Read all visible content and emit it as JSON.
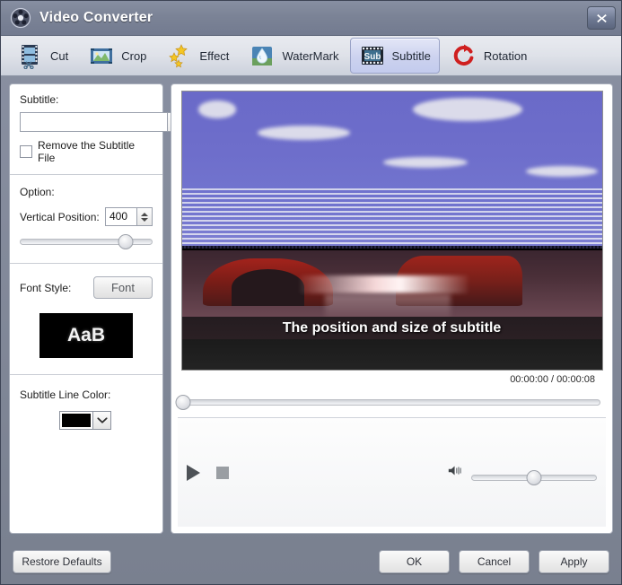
{
  "window": {
    "title": "Video Converter",
    "logo_icon": "film-reel-icon",
    "close_icon": "close-icon"
  },
  "tabs": [
    {
      "label": "Cut",
      "icon": "film-scissors-icon",
      "active": false
    },
    {
      "label": "Crop",
      "icon": "crop-frame-icon",
      "active": false
    },
    {
      "label": "Effect",
      "icon": "stars-icon",
      "active": false
    },
    {
      "label": "WaterMark",
      "icon": "water-drop-icon",
      "active": false
    },
    {
      "label": "Subtitle",
      "icon": "sub-film-icon",
      "active": true
    },
    {
      "label": "Rotation",
      "icon": "rotate-arrow-icon",
      "active": false
    }
  ],
  "sidebar": {
    "subtitle_label": "Subtitle:",
    "subtitle_path_value": "",
    "subtitle_path_placeholder": "",
    "browse_icon": "folder-icon",
    "remove_checkbox_label": "Remove the Subtitle File",
    "remove_checkbox_checked": false,
    "option_label": "Option:",
    "vertical_position_label": "Vertical Position:",
    "vertical_position_value": "400",
    "vertical_position_slider_percent": 80,
    "font_style_label": "Font Style:",
    "font_button_label": "Font",
    "font_preview_text": "AaB",
    "font_preview_bg": "#000000",
    "font_preview_fg": "#f2f2f2",
    "subtitle_line_color_label": "Subtitle Line Color:",
    "subtitle_line_color_value": "#000000",
    "color_dropdown_icon": "chevron-down-icon"
  },
  "preview": {
    "subtitle_overlay_text": "The position and size of subtitle",
    "current_time": "00:00:00",
    "total_time": "00:00:08",
    "time_display": "00:00:00 / 00:00:08",
    "progress_percent": 0,
    "play_icon": "play-icon",
    "stop_icon": "stop-icon",
    "volume_icon": "speaker-icon",
    "volume_percent": 50
  },
  "footer": {
    "restore_label": "Restore Defaults",
    "ok_label": "OK",
    "cancel_label": "Cancel",
    "apply_label": "Apply"
  },
  "colors": {
    "titlebar": "#7b8396",
    "window_chrome": "#79808f",
    "tab_active": "#ccd2ef",
    "panel_bg": "#ffffff"
  }
}
